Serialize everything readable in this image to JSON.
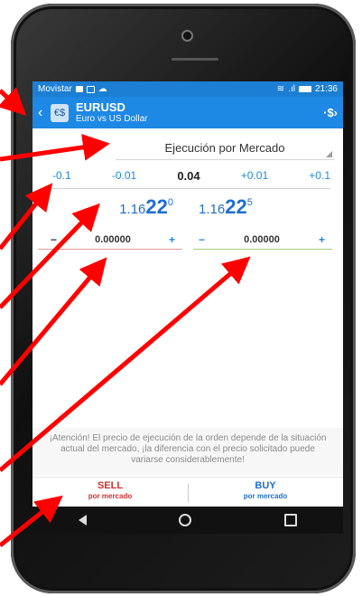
{
  "status": {
    "carrier": "Movistar",
    "time": "21:36"
  },
  "appbar": {
    "symbol": "EURUSD",
    "description": "Euro vs US Dollar",
    "action_label": "·$›"
  },
  "order_type": "Ejecución por Mercado",
  "volume": {
    "dec_large": "-0.1",
    "dec_small": "-0.01",
    "value": "0.04",
    "inc_small": "+0.01",
    "inc_large": "+0.1"
  },
  "prices": {
    "sell": {
      "small": "1.16",
      "big": "22",
      "sup": "0"
    },
    "buy": {
      "small": "1.16",
      "big": "22",
      "sup": "5"
    }
  },
  "stop_loss": {
    "minus": "−",
    "value": "0.00000",
    "plus": "+"
  },
  "take_profit": {
    "minus": "−",
    "value": "0.00000",
    "plus": "+"
  },
  "warning": "¡Atención! El precio de ejecución de la orden depende de la situación actual del mercado, ¡la diferencia con el precio solicitado puede variarse considerablemente!",
  "trade": {
    "sell_label": "SELL",
    "sell_sub": "por mercado",
    "buy_label": "BUY",
    "buy_sub": "por mercado"
  },
  "colors": {
    "appbar": "#1e88e5",
    "sell": "#d32f2f",
    "buy": "#1e6fd0",
    "annotation": "#ff0000"
  }
}
